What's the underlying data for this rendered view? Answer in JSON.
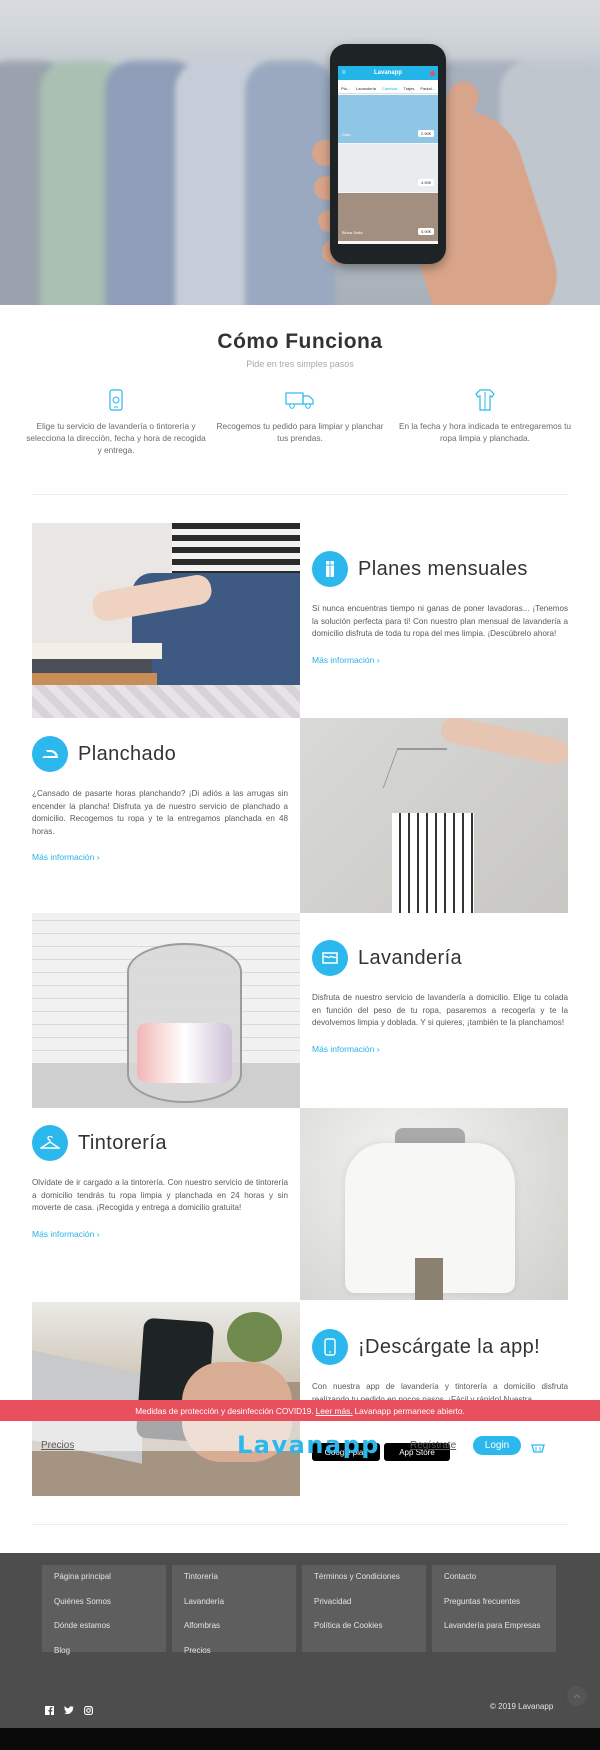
{
  "hero": {
    "app_logo": "Lavanapp",
    "app_tabs": [
      "Pla...",
      "Lavandería",
      "Camisas",
      "Trajes",
      "Pantal..."
    ],
    "app_cards": [
      {
        "label": "Cam...",
        "price": "2.90€"
      },
      {
        "label": "",
        "price": "4.50€"
      },
      {
        "label": "Blusa Seda",
        "price": "5.90€"
      }
    ]
  },
  "how": {
    "title": "Cómo Funciona",
    "subtitle": "Pide en tres simples pasos",
    "steps": [
      {
        "icon": "phone-icon",
        "text": "Elige tu servicio de lavandería o tintorería y selecciona la dirección, fecha y hora de recogida y entrega."
      },
      {
        "icon": "truck-icon",
        "text": "Recogemos tu pedido para limpiar y planchar tus prendas."
      },
      {
        "icon": "shirt-icon",
        "text": "En la fecha y hora indicada te entregaremos tu ropa limpia y planchada."
      }
    ]
  },
  "features": [
    {
      "title": "Planes mensuales",
      "icon": "pin-icon",
      "desc": "Si nunca encuentras tiempo ni ganas de poner lavadoras... ¡Tenemos la solución perfecta para ti! Con nuestro plan mensual de lavandería a domicilio disfruta de toda tu ropa del mes limpia. ¡Descúbrelo ahora!",
      "link": "Más información ›"
    },
    {
      "title": "Planchado",
      "icon": "iron-icon",
      "desc": "¿Cansado de pasarte horas planchando? ¡Di adiós a las arrugas sin encender la plancha! Disfruta ya de nuestro servicio de planchado a domicilio. Recogemos tu ropa y te la entregamos planchada en 48 horas.",
      "link": "Más información ›"
    },
    {
      "title": "Lavandería",
      "icon": "water-icon",
      "desc": "Disfruta de nuestro servicio de lavandería a domicilio. Elige tu colada en función del peso de tu ropa, pasaremos a recogerla y te la devolvemos limpia y doblada. Y si quieres, ¡también te la planchamos!",
      "link": "Más información ›"
    },
    {
      "title": "Tintorería",
      "icon": "hanger-icon",
      "desc": "Olvídate de ir cargado a la tintorería. Con nuestro servicio de tintorería a domicilio tendrás tu ropa limpia y planchada en 24 horas y sin moverte de casa. ¡Recogida y entrega a domicilio gratuita!",
      "link": "Más información ›"
    },
    {
      "title": "¡Descárgate la app!",
      "icon": "smartphone-icon",
      "desc": "Con nuestra app de lavandería y tintorería a domicilio disfruta realizando tu pedido en pocos pasos. ¡Fácil y rápido! Nuestra"
    }
  ],
  "covid": {
    "text": "Medidas de protección y desinfección COVID19.",
    "link": "Leer más.",
    "tail": "Lavanapp permanece abierto."
  },
  "nav": {
    "precios": "Precios",
    "logo": "Lavanapp",
    "registrate": "Regístrate",
    "login": "Login"
  },
  "stores": {
    "google": "Google play",
    "apple": "App Store"
  },
  "footer": {
    "col1": [
      "Página principal",
      "Quiénes Somos",
      "Dónde estamos",
      "Blog"
    ],
    "col2": [
      "Tintorería",
      "Lavandería",
      "Alfombras",
      "Precios"
    ],
    "col3": [
      "Términos y Condiciones",
      "Privacidad",
      "Política de Cookies"
    ],
    "col4": [
      "Contacto",
      "Preguntas frecuentes",
      "Lavandería para Empresas"
    ],
    "copyright": "© 2019 Lavanapp"
  },
  "colors": {
    "accent": "#2cb8ec",
    "covid": "#e8505d",
    "footer": "#4d4d4d"
  }
}
